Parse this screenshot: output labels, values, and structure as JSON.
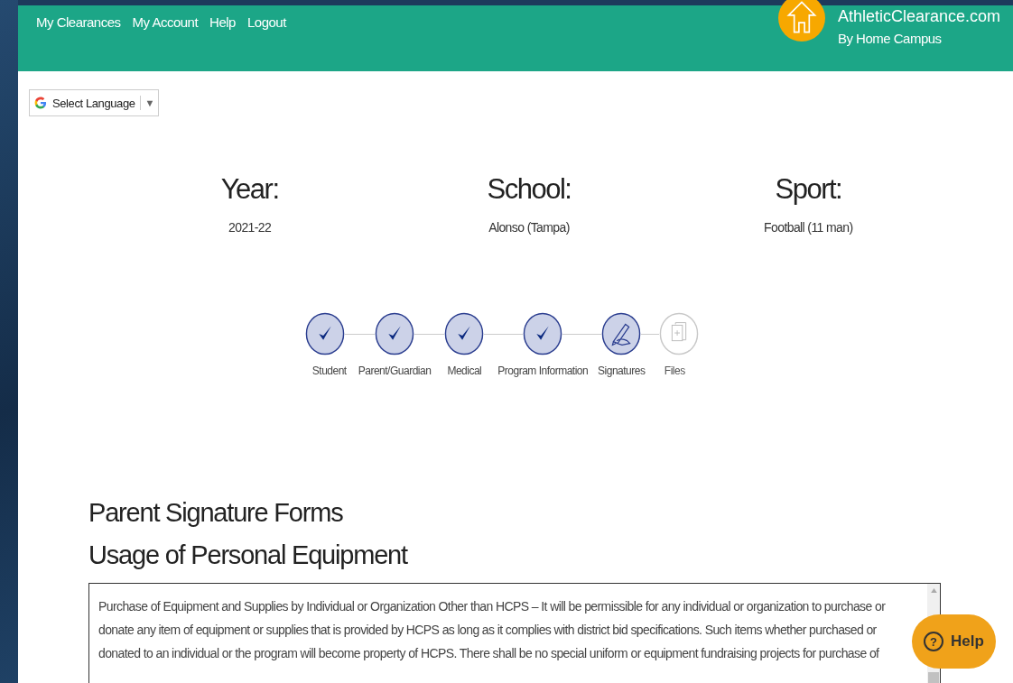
{
  "nav": [
    "My Clearances",
    "My Account",
    "Help",
    "Logout"
  ],
  "brand": {
    "title": "AthleticClearance.com",
    "subtitle": "By Home Campus"
  },
  "language_select": {
    "label": "Select Language",
    "caret": "▼"
  },
  "summary": [
    {
      "heading": "Year:",
      "value": "2021-22"
    },
    {
      "heading": "School:",
      "value": "Alonso (Tampa)"
    },
    {
      "heading": "Sport:",
      "value": "Football (11 man)"
    }
  ],
  "steps": [
    {
      "label": "Student",
      "kind": "done"
    },
    {
      "label": "Parent/Guardian",
      "kind": "done"
    },
    {
      "label": "Medical",
      "kind": "done"
    },
    {
      "label": "Program Information",
      "kind": "done"
    },
    {
      "label": "Signatures",
      "kind": "current"
    },
    {
      "label": "Files",
      "kind": "pending"
    }
  ],
  "page_title": "Parent Signature Forms",
  "section_title": "Usage of Personal Equipment",
  "form_text": "Purchase of Equipment and Supplies by Individual or Organization Other than HCPS – It will be permissible for any individual or organization to purchase or donate any item of equipment or supplies that is provided by HCPS as long as it complies with district bid specifications.  Such items whether purchased or donated to an individual or the program will become property of HCPS.  There shall be no special uniform or equipment fundraising projects for purchase of",
  "help_button": {
    "icon": "?",
    "label": "Help"
  }
}
